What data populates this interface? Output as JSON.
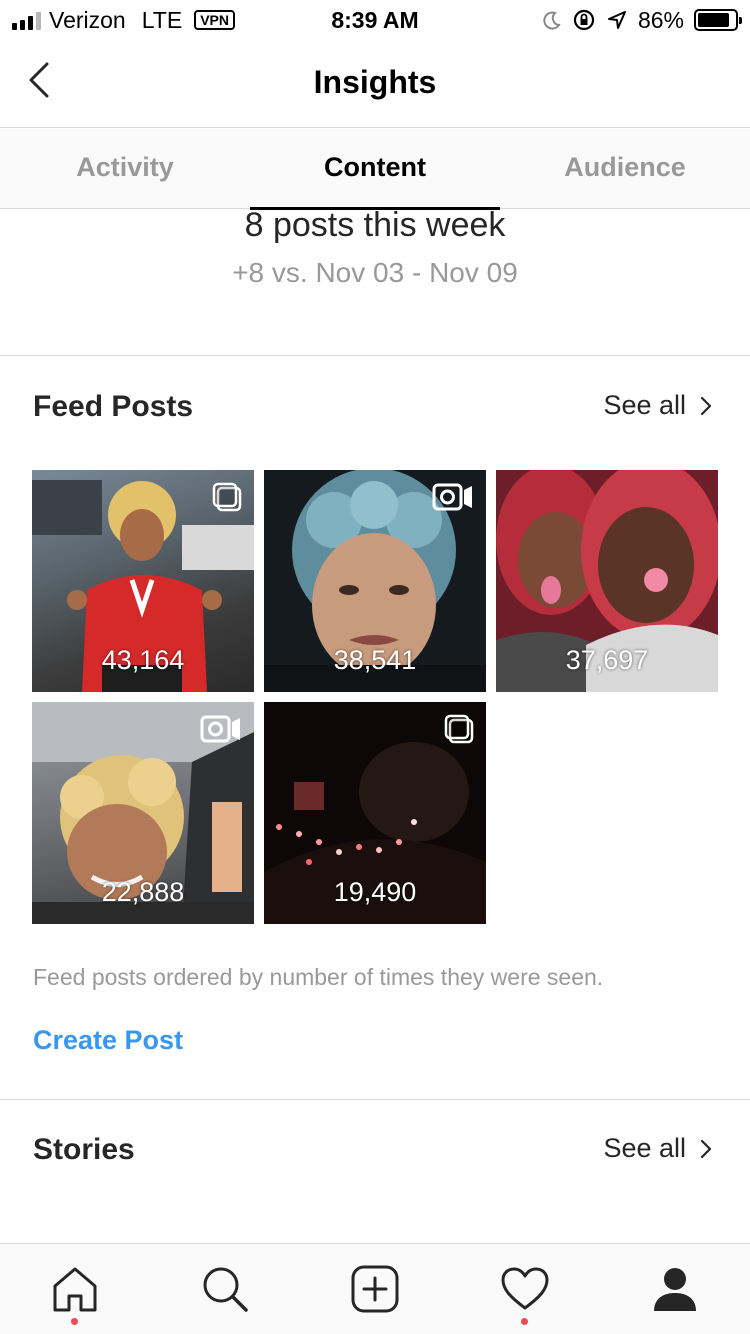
{
  "status_bar": {
    "carrier": "Verizon",
    "network": "LTE",
    "vpn": "VPN",
    "time": "8:39 AM",
    "battery": "86%",
    "battery_level": 0.86
  },
  "header": {
    "title": "Insights"
  },
  "tabs": [
    {
      "label": "Activity",
      "active": false
    },
    {
      "label": "Content",
      "active": true
    },
    {
      "label": "Audience",
      "active": false
    }
  ],
  "summary": {
    "headline": "8 posts this week",
    "comparison": "+8 vs. Nov 03 - Nov 09"
  },
  "feed_posts": {
    "title": "Feed Posts",
    "see_all": "See all",
    "posts": [
      {
        "count": "43,164",
        "type": "carousel"
      },
      {
        "count": "38,541",
        "type": "video"
      },
      {
        "count": "37,697",
        "type": "photo"
      },
      {
        "count": "22,888",
        "type": "video"
      },
      {
        "count": "19,490",
        "type": "carousel"
      }
    ],
    "note": "Feed posts ordered by number of times they were seen.",
    "create_label": "Create Post"
  },
  "stories": {
    "title": "Stories",
    "see_all": "See all"
  },
  "bottom_nav": [
    {
      "icon": "home-icon",
      "dot": true
    },
    {
      "icon": "search-icon",
      "dot": false
    },
    {
      "icon": "new-post-icon",
      "dot": false
    },
    {
      "icon": "heart-icon",
      "dot": true
    },
    {
      "icon": "profile-icon",
      "dot": false
    }
  ],
  "colors": {
    "accent": "#3897f0",
    "notification_dot": "#ed4956",
    "muted_text": "#999999"
  }
}
